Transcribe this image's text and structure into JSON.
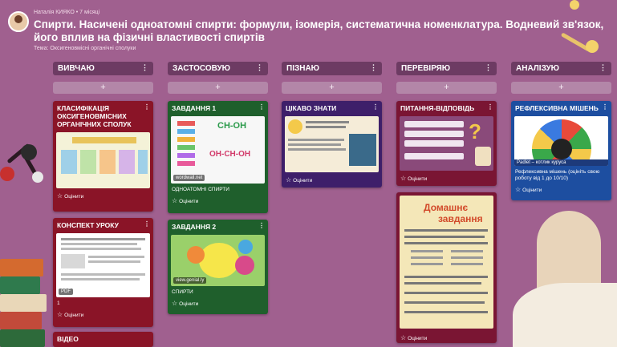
{
  "header": {
    "meta": "Наталія КИЯКО • 7 місяці",
    "title": "Спирти. Насичені одноатомні спирти: формули, ізомерія, систематична номенклатура. Водневий зв'язок, його вплив на фізичні властивості спиртів",
    "subtitle": "Тема: Оксигеновмісні органічні сполуки"
  },
  "columns": [
    {
      "label": "ВИВЧАЮ",
      "add": "+"
    },
    {
      "label": "ЗАСТОСОВУЮ",
      "add": "+"
    },
    {
      "label": "ПІЗНАЮ",
      "add": "+"
    },
    {
      "label": "ПЕРЕВІРЯЮ",
      "add": "+"
    },
    {
      "label": "АНАЛІЗУЮ",
      "add": "+"
    }
  ],
  "cards": {
    "classification": {
      "title": "КЛАСИФІКАЦІЯ ОКСИГЕНОВМІСНИХ ОРГАНІЧНИХ СПОЛУК",
      "rate": "Оцінити"
    },
    "lesson_notes": {
      "title": "КОНСПЕКТ УРОКУ",
      "tag": "PDF",
      "body": "1",
      "rate": "Оцінити"
    },
    "video": {
      "title": "ВІДЕО"
    },
    "task1": {
      "title": "ЗАВДАННЯ 1",
      "source": "wordwall.net",
      "body": "ОДНОАТОМНІ СПИРТИ",
      "rate": "Оцінити",
      "formula1": "CH-OH",
      "formula2": "OH-CH-OH"
    },
    "task2": {
      "title": "ЗАВДАННЯ 2",
      "source": "view.genial.ly",
      "body": "СПИРТИ",
      "rate": "Оцінити"
    },
    "interesting": {
      "title": "ЦІКАВО ЗНАТИ",
      "rate": "Оцінити"
    },
    "qa": {
      "title": "ПИТАННЯ-ВІДПОВІДЬ",
      "rate": "Оцінити"
    },
    "homework": {
      "heading1": "Домашнє",
      "heading2": "завдання",
      "rate": "Оцінити"
    },
    "reflection": {
      "title": "РЕФЛЕКСИВНА МІШЕНЬ",
      "image_caption": "Padlet – котлик куруса",
      "body": "Рефлексивна мішень (оцініть свою роботу від 1 до 10/10)",
      "rate": "Оцінити"
    }
  }
}
